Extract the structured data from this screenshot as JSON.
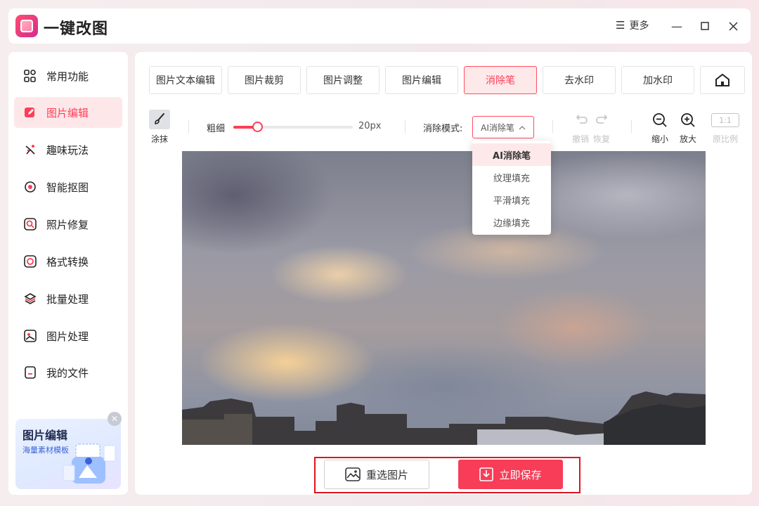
{
  "app": {
    "title": "一键改图",
    "more_label": "更多"
  },
  "sidebar": {
    "items": [
      {
        "label": "常用功能",
        "icon": "grid-icon"
      },
      {
        "label": "图片编辑",
        "icon": "edit-icon",
        "active": true
      },
      {
        "label": "趣味玩法",
        "icon": "sparkle-icon"
      },
      {
        "label": "智能抠图",
        "icon": "target-icon"
      },
      {
        "label": "照片修复",
        "icon": "repair-icon"
      },
      {
        "label": "格式转换",
        "icon": "convert-icon"
      },
      {
        "label": "批量处理",
        "icon": "layers-icon"
      },
      {
        "label": "图片处理",
        "icon": "image-icon"
      },
      {
        "label": "我的文件",
        "icon": "file-icon"
      }
    ],
    "promo": {
      "title": "图片编辑",
      "subtitle": "海量素材模板"
    }
  },
  "tabs": [
    {
      "label": "图片文本编辑"
    },
    {
      "label": "图片裁剪"
    },
    {
      "label": "图片调整"
    },
    {
      "label": "图片编辑"
    },
    {
      "label": "消除笔",
      "active": true
    },
    {
      "label": "去水印"
    },
    {
      "label": "加水印"
    }
  ],
  "toolbar": {
    "smear_label": "涂抹",
    "thickness_label": "粗细",
    "thickness_value": "20px",
    "thickness_level": 0.2,
    "mode_label": "消除模式:",
    "mode_selected": "AI消除笔",
    "mode_options": [
      "AI消除笔",
      "纹理填充",
      "平滑填充",
      "边缘填充"
    ],
    "undo_label": "撤销",
    "redo_label": "恢复",
    "zoom_out_label": "缩小",
    "zoom_in_label": "放大",
    "ratio_badge": "1:1",
    "ratio_label": "原比例"
  },
  "actions": {
    "reselect_label": "重选图片",
    "save_label": "立即保存"
  },
  "colors": {
    "accent": "#ff3d57",
    "save_button": "#f73d58",
    "highlight_frame": "#e0141e"
  }
}
